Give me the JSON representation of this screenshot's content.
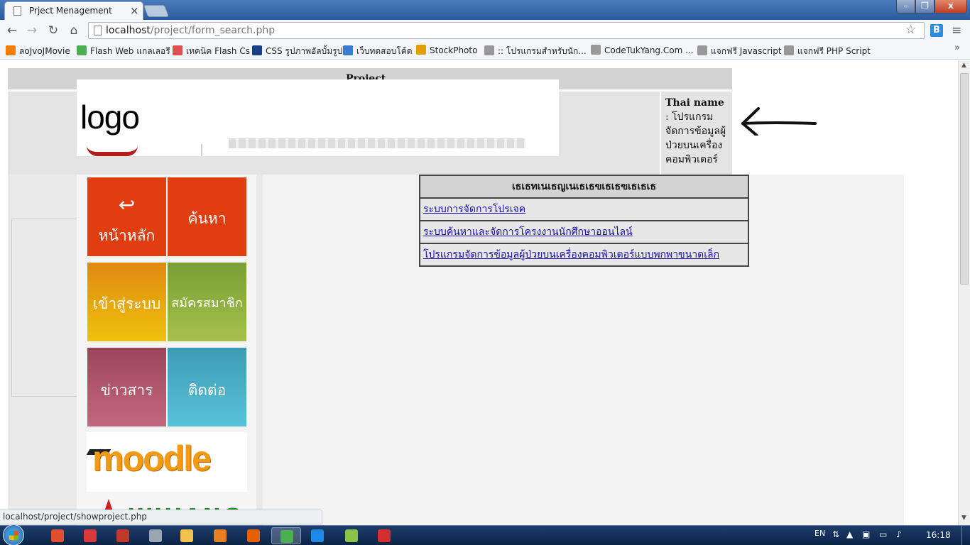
{
  "window": {
    "tab_title": "Prject Menagement",
    "tab_close": "×",
    "controls": {
      "minimize": "–",
      "maximize": "❐",
      "close": "x"
    }
  },
  "toolbar": {
    "back": "←",
    "forward": "→",
    "reload": "↻",
    "home": "⌂",
    "url_host": "localhost",
    "url_path": "/project/form_search.php",
    "star": "☆",
    "ext_label": "B",
    "menu": "≡"
  },
  "bookmarks": {
    "items": [
      {
        "label": "ลoJvoJMovie",
        "icon": "blogger-icon",
        "color": "#f57d00"
      },
      {
        "label": "Flash Web แกลเลอรี",
        "icon": "heart-icon",
        "color": "#4caf50"
      },
      {
        "label": "เทคนิค Flash Cs",
        "icon": "swirl-icon",
        "color": "#e05050"
      },
      {
        "label": "CSS รูปภาพอัลบั้มรูป",
        "icon": "w3c-icon",
        "color": "#1a3f8a"
      },
      {
        "label": "เว็บทดสอบโค้ด",
        "icon": "cloud-icon",
        "color": "#3a7bd5"
      },
      {
        "label": "StockPhoto",
        "icon": "photo-icon",
        "color": "#e0a000"
      },
      {
        "label": ":: โปรแกรมสำหรับนัก...",
        "icon": "page-icon",
        "color": "#999999"
      },
      {
        "label": "CodeTukYang.Com ...",
        "icon": "page-icon",
        "color": "#999999"
      },
      {
        "label": "แจกฟรี Javascript",
        "icon": "page-icon",
        "color": "#999999"
      },
      {
        "label": "แจกฟรี PHP Script",
        "icon": "page-icon",
        "color": "#999999"
      }
    ],
    "more": "»"
  },
  "page": {
    "header_title": "Project",
    "logo_text": "logo",
    "thai_name_label": "Thai name",
    "thai_name_value": ": โปรแกรมจัดการข้อมูลผู้ป่วยบนเครื่องคอมพิวเตอร์",
    "tiles": {
      "home": "หน้าหลัก",
      "home_icon": "↩",
      "search": "ค้นหา",
      "login": "เข้าสู่ระบบ",
      "register": "สมัครสมาชิก",
      "news": "ข่าวสาร",
      "contact": "ติดต่อ"
    },
    "moodle_text": "moodle",
    "banner_text": "WHIANG",
    "table": {
      "header": "เธเธทเนเธญเนเธเธฃเธเธฃเธเธเธ",
      "rows": [
        "ระบบการจัดการโปรเจค",
        "ระบบค้นหาและจัดการโครงงานนักศึกษาออนไลน์",
        "โปรแกรมจัดการข้อมูลผู้ป่วยบนเครื่องคอมพิวเตอร์แบบพกพาขนาดเล็ก"
      ]
    }
  },
  "status_bar": {
    "url": "localhost/project/showproject.php"
  },
  "taskbar": {
    "lang": "EN",
    "clock": "16:18",
    "apps": [
      {
        "name": "taskbar-app-screenshot",
        "color": "#e05030"
      },
      {
        "name": "taskbar-app-upload",
        "color": "#d63a3a"
      },
      {
        "name": "taskbar-app-tool",
        "color": "#c0392b"
      },
      {
        "name": "taskbar-app-game",
        "color": "#9aa6b2"
      },
      {
        "name": "taskbar-app-explorer",
        "color": "#f2c14e"
      },
      {
        "name": "taskbar-app-media",
        "color": "#e67e22"
      },
      {
        "name": "taskbar-app-firefox",
        "color": "#e66000"
      },
      {
        "name": "taskbar-app-chrome",
        "color": "#4caf50"
      },
      {
        "name": "taskbar-app-ie",
        "color": "#1e88e5"
      },
      {
        "name": "taskbar-app-notepad",
        "color": "#8bc34a"
      },
      {
        "name": "taskbar-app-editor",
        "color": "#d32f2f"
      }
    ]
  }
}
